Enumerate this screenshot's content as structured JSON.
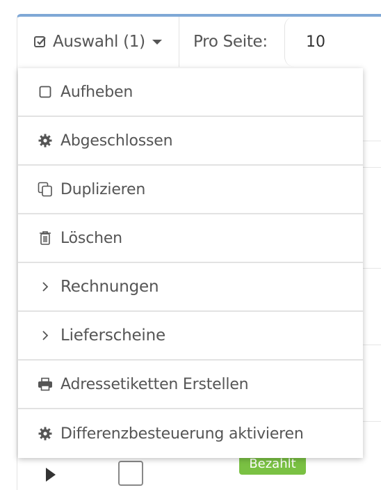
{
  "toolbar": {
    "select_label": "Auswahl (1)",
    "per_page_label": "Pro Seite:",
    "per_page_value": "10"
  },
  "dropdown": {
    "items": [
      {
        "label": "Aufheben",
        "icon": "square-icon"
      },
      {
        "label": "Abgeschlossen",
        "icon": "gear-icon"
      },
      {
        "label": "Duplizieren",
        "icon": "copy-icon"
      },
      {
        "label": "Löschen",
        "icon": "trash-icon"
      },
      {
        "label": "Rechnungen",
        "icon": "chevron-right-icon"
      },
      {
        "label": "Lieferscheine",
        "icon": "chevron-right-icon"
      },
      {
        "label": "Adressetiketten Erstellen",
        "icon": "printer-icon"
      },
      {
        "label": "Differenzbesteuerung aktivieren",
        "icon": "gear-icon"
      }
    ]
  },
  "background": {
    "status_badge": "Bezahlt",
    "badge_color": "#7ac143"
  }
}
